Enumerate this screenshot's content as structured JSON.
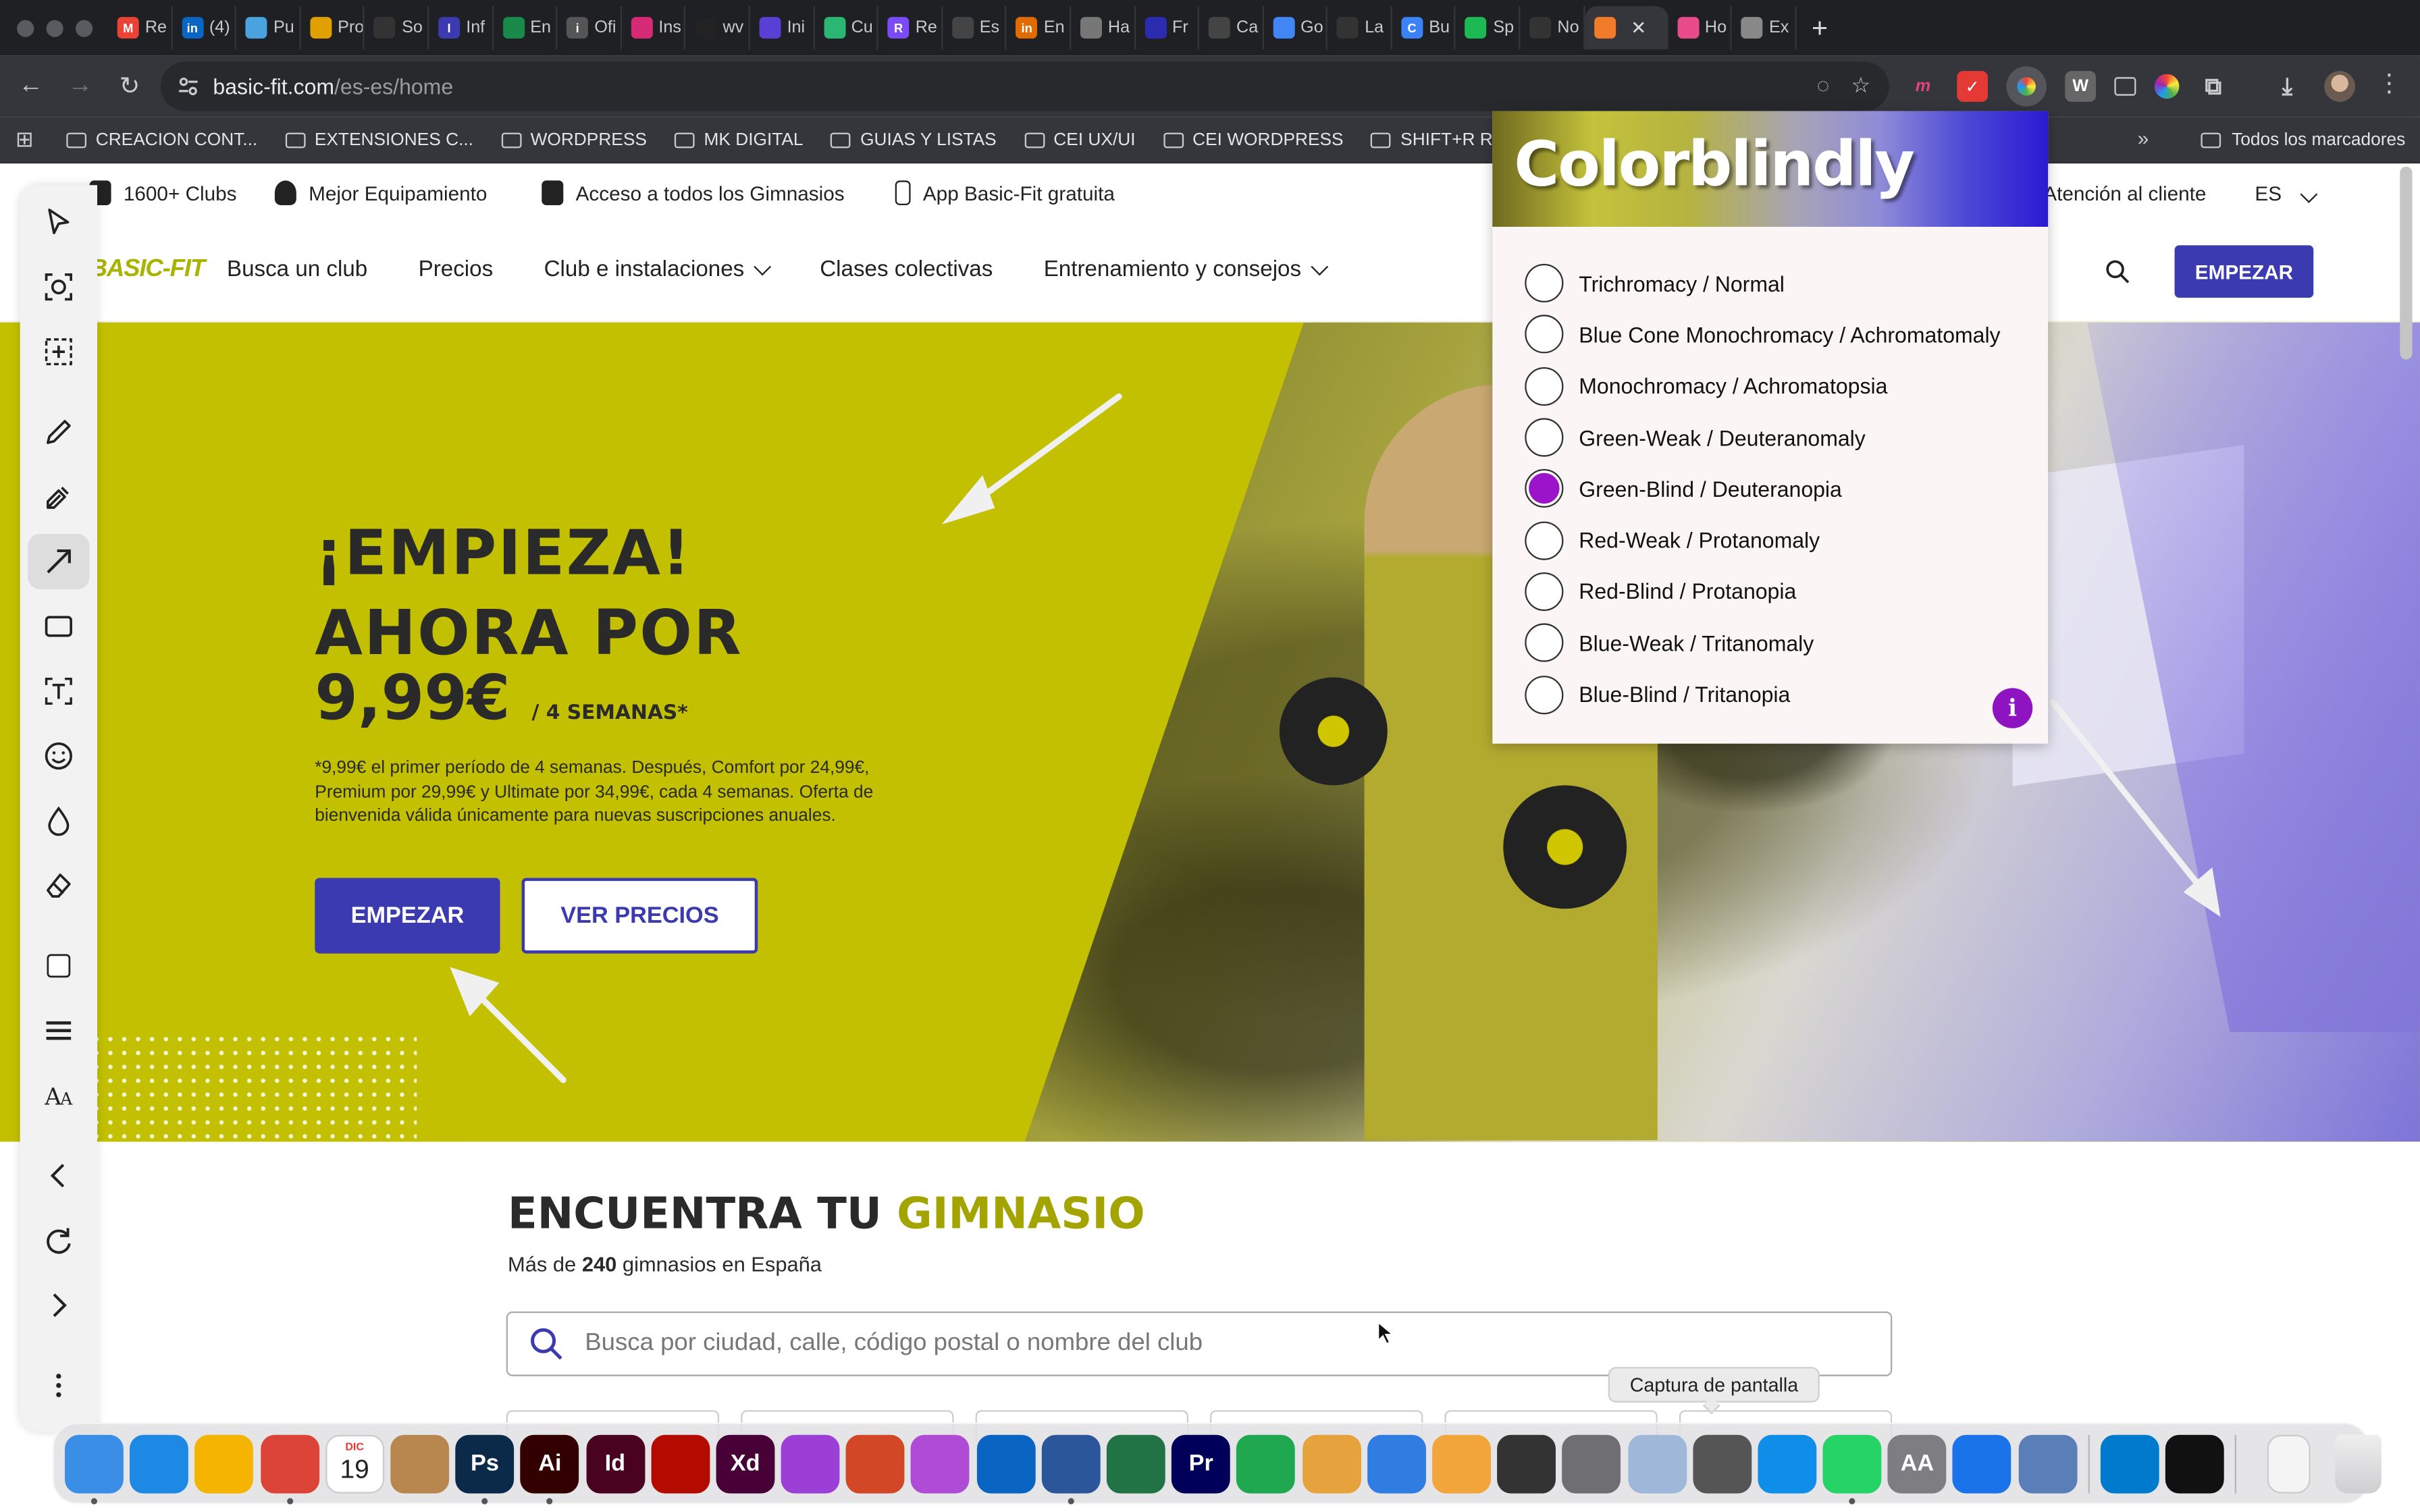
{
  "browser": {
    "tabs": [
      {
        "title": "Re",
        "color": "#ea4335",
        "glyph": "M"
      },
      {
        "title": "(4)",
        "color": "#0a66c2",
        "glyph": "in"
      },
      {
        "title": "Pu",
        "color": "#4aa3df",
        "glyph": ""
      },
      {
        "title": "Pro",
        "color": "#e0a100",
        "glyph": ""
      },
      {
        "title": "So",
        "color": "#333333",
        "glyph": ""
      },
      {
        "title": "Inf",
        "color": "#3b3ab0",
        "glyph": "I"
      },
      {
        "title": "En",
        "color": "#1a8a4a",
        "glyph": ""
      },
      {
        "title": "Ofi",
        "color": "#555555",
        "glyph": "i"
      },
      {
        "title": "Ins",
        "color": "#d62976",
        "glyph": ""
      },
      {
        "title": "wv",
        "color": "#222222",
        "glyph": ""
      },
      {
        "title": "Ini",
        "color": "#5a3fd6",
        "glyph": ""
      },
      {
        "title": "Cu",
        "color": "#2bb673",
        "glyph": ""
      },
      {
        "title": "Re",
        "color": "#7b4cf5",
        "glyph": "R"
      },
      {
        "title": "Es",
        "color": "#444444",
        "glyph": ""
      },
      {
        "title": "En",
        "color": "#e06b00",
        "glyph": "in"
      },
      {
        "title": "Ha",
        "color": "#777777",
        "glyph": ""
      },
      {
        "title": "Fr",
        "color": "#2c2cb0",
        "glyph": ""
      },
      {
        "title": "Ca",
        "color": "#444444",
        "glyph": ""
      },
      {
        "title": "Go",
        "color": "#4285f4",
        "glyph": ""
      },
      {
        "title": "La",
        "color": "#333333",
        "glyph": ""
      },
      {
        "title": "Bu",
        "color": "#3b82f6",
        "glyph": "C"
      },
      {
        "title": "Sp",
        "color": "#1db954",
        "glyph": ""
      },
      {
        "title": "No",
        "color": "#333333",
        "glyph": ""
      },
      {
        "title": "",
        "color": "#f27b2a",
        "glyph": "",
        "active": true
      },
      {
        "title": "Ho",
        "color": "#e84b8a",
        "glyph": ""
      },
      {
        "title": "Ex",
        "color": "#888888",
        "glyph": ""
      }
    ],
    "url_host": "basic-fit.com",
    "url_path": "/es-es/home",
    "bookmarks": [
      "CREACION CONT...",
      "EXTENSIONES C...",
      "WORDPRESS",
      "MK DIGITAL",
      "GUIAS Y LISTAS",
      "CEI UX/UI",
      "CEI WORDPRESS",
      "SHIFT+R RAÚL M..."
    ],
    "bookmarks_all": "Todos los marcadores"
  },
  "site": {
    "topinfo": {
      "clubs": "1600+ Clubs",
      "equipment": "Mejor Equipamiento",
      "access": "Acceso a todos los Gimnasios",
      "app": "App Basic-Fit gratuita",
      "support": "Atención al cliente",
      "lang": "ES"
    },
    "logo": "BASIC-FIT",
    "nav": {
      "find_club": "Busca un club",
      "prices": "Precios",
      "club_facilities": "Club e instalaciones",
      "group_classes": "Clases colectivas",
      "training": "Entrenamiento y consejos",
      "cta": "EMPEZAR"
    },
    "hero": {
      "title_line1": "¡EMPIEZA!",
      "title_line2": "AHORA POR",
      "price": "9,99€",
      "price_period": "/ 4 SEMANAS*",
      "fineprint": "*9,99€ el primer período de 4 semanas. Después, Comfort por 24,99€, Premium por 29,99€ y Ultimate por 34,99€, cada 4 semanas. Oferta de bienvenida válida únicamente para nuevas suscripciones anuales.",
      "btn_primary": "EMPEZAR",
      "btn_secondary": "VER PRECIOS"
    },
    "gym_finder": {
      "title_part1": "ENCUENTRA TU",
      "title_part2": "GIMNASIO",
      "sub_prefix": "Más de",
      "sub_count": "240",
      "sub_suffix": "gimnasios en España",
      "search_placeholder": "Busca por ciudad, calle, código postal o nombre del club"
    }
  },
  "colorblindly": {
    "title": "Colorblindly",
    "options": [
      "Trichromacy / Normal",
      "Blue Cone Monochromacy / Achromatomaly",
      "Monochromacy / Achromatopsia",
      "Green-Weak / Deuteranomaly",
      "Green-Blind / Deuteranopia",
      "Red-Weak / Protanomaly",
      "Red-Blind / Protanopia",
      "Blue-Weak / Tritanomaly",
      "Blue-Blind / Tritanopia"
    ],
    "selected_index": 4,
    "selected_color": "#9b14c9"
  },
  "tooltip": "Captura de pantalla",
  "dock": {
    "calendar_month": "DIC",
    "calendar_day": "19",
    "apps": [
      {
        "name": "finder",
        "color": "#3a8ee6",
        "glyph": "",
        "dot": true
      },
      {
        "name": "safari",
        "color": "#1e88e5",
        "glyph": ""
      },
      {
        "name": "photos",
        "color": "#f4b400",
        "glyph": ""
      },
      {
        "name": "chrome",
        "color": "#db4437",
        "glyph": "",
        "dot": true
      },
      {
        "name": "calendar",
        "color": "#ffffff",
        "glyph": ""
      },
      {
        "name": "contacts",
        "color": "#b8874f",
        "glyph": ""
      },
      {
        "name": "photoshop",
        "color": "#0b2a4a",
        "glyph": "Ps",
        "dot": true
      },
      {
        "name": "illustrator",
        "color": "#330000",
        "glyph": "Ai",
        "dot": true
      },
      {
        "name": "indesign",
        "color": "#49021f",
        "glyph": "Id"
      },
      {
        "name": "acrobat",
        "color": "#b30b00",
        "glyph": ""
      },
      {
        "name": "xd",
        "color": "#470137",
        "glyph": "Xd"
      },
      {
        "name": "podcasts",
        "color": "#9b3fd6",
        "glyph": ""
      },
      {
        "name": "powerpoint",
        "color": "#d24726",
        "glyph": ""
      },
      {
        "name": "flower",
        "color": "#b04bd6",
        "glyph": ""
      },
      {
        "name": "outlook",
        "color": "#0a64c2",
        "glyph": ""
      },
      {
        "name": "word",
        "color": "#2b579a",
        "glyph": "",
        "dot": true
      },
      {
        "name": "excel",
        "color": "#217346",
        "glyph": ""
      },
      {
        "name": "premiere",
        "color": "#00005b",
        "glyph": "Pr"
      },
      {
        "name": "numbers",
        "color": "#1fa84f",
        "glyph": ""
      },
      {
        "name": "recycle",
        "color": "#e6a23c",
        "glyph": ""
      },
      {
        "name": "keynote",
        "color": "#2f7de1",
        "glyph": ""
      },
      {
        "name": "pages",
        "color": "#f2a53b",
        "glyph": ""
      },
      {
        "name": "calculator",
        "color": "#333333",
        "glyph": ""
      },
      {
        "name": "settings",
        "color": "#6e6e73",
        "glyph": ""
      },
      {
        "name": "cloud-app",
        "color": "#9fb8d9",
        "glyph": ""
      },
      {
        "name": "screenshot",
        "color": "#555555",
        "glyph": ""
      },
      {
        "name": "teamviewer",
        "color": "#0e8ee9",
        "glyph": ""
      },
      {
        "name": "whatsapp",
        "color": "#25d366",
        "glyph": "",
        "dot": true
      },
      {
        "name": "font-book",
        "color": "#7d7d82",
        "glyph": "AA"
      },
      {
        "name": "freeform",
        "color": "#1a73e8",
        "glyph": ""
      },
      {
        "name": "system-info",
        "color": "#5a7fb8",
        "glyph": ""
      },
      {
        "name": "vscode",
        "color": "#007acc",
        "glyph": ""
      },
      {
        "name": "capcut",
        "color": "#111111",
        "glyph": ""
      }
    ]
  }
}
